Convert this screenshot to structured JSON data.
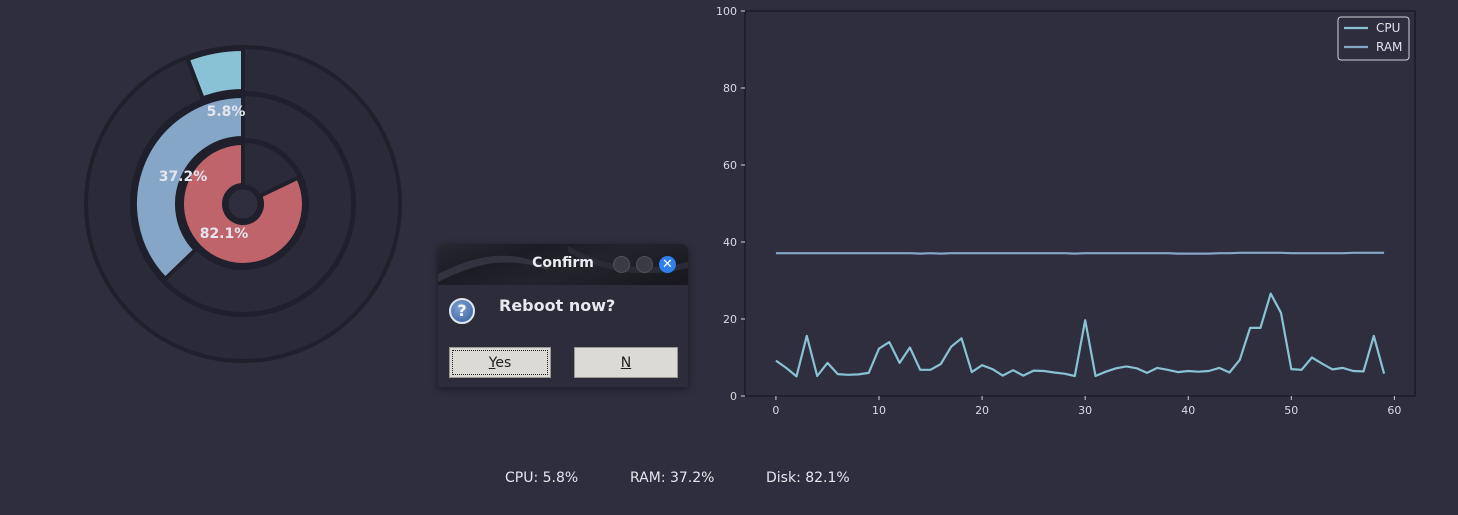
{
  "gauge": {
    "rings": [
      {
        "name": "CPU",
        "percent": 5.8,
        "label": "5.8%",
        "color": "#89c2d4"
      },
      {
        "name": "RAM",
        "percent": 37.2,
        "label": "37.2%",
        "color": "#86a6c7"
      },
      {
        "name": "Disk",
        "percent": 82.1,
        "label": "82.1%",
        "color": "#c0646b"
      }
    ],
    "track_color": "#20202c"
  },
  "chart_data": {
    "type": "line",
    "xlim": [
      -3,
      62
    ],
    "ylim": [
      0,
      100
    ],
    "x_ticks": [
      0,
      10,
      20,
      30,
      40,
      50,
      60
    ],
    "y_ticks": [
      0,
      20,
      40,
      60,
      80,
      100
    ],
    "legend": {
      "position": "top-right",
      "entries": [
        "CPU",
        "RAM"
      ]
    },
    "grid": false,
    "series": [
      {
        "name": "CPU",
        "color": "#89c2d4",
        "values": [
          9.2,
          7.3,
          5.1,
          15.6,
          5.2,
          8.6,
          5.7,
          5.5,
          5.6,
          6.0,
          12.3,
          14.0,
          8.6,
          12.6,
          6.8,
          6.8,
          8.3,
          12.8,
          15.0,
          6.2,
          8.0,
          7.0,
          5.3,
          6.7,
          5.3,
          6.6,
          6.5,
          6.1,
          5.8,
          5.2,
          19.7,
          5.2,
          6.3,
          7.2,
          7.7,
          7.2,
          6.0,
          7.3,
          6.8,
          6.2,
          6.5,
          6.3,
          6.5,
          7.3,
          6.1,
          9.4,
          17.7,
          17.7,
          26.6,
          21.6,
          7.0,
          6.8,
          10.0,
          8.4,
          6.9,
          7.3,
          6.5,
          6.4,
          15.6,
          5.8
        ]
      },
      {
        "name": "RAM",
        "color": "#86a6c7",
        "values": [
          37.1,
          37.1,
          37.1,
          37.1,
          37.1,
          37.1,
          37.1,
          37.1,
          37.1,
          37.1,
          37.1,
          37.1,
          37.1,
          37.1,
          37.0,
          37.1,
          37.0,
          37.1,
          37.1,
          37.1,
          37.1,
          37.1,
          37.1,
          37.1,
          37.1,
          37.1,
          37.1,
          37.1,
          37.1,
          37.0,
          37.1,
          37.1,
          37.1,
          37.1,
          37.1,
          37.1,
          37.1,
          37.1,
          37.1,
          37.0,
          37.0,
          37.0,
          37.0,
          37.1,
          37.1,
          37.2,
          37.2,
          37.2,
          37.2,
          37.2,
          37.1,
          37.1,
          37.1,
          37.1,
          37.1,
          37.1,
          37.2,
          37.2,
          37.2,
          37.2
        ]
      }
    ]
  },
  "dialog": {
    "title": "Confirm",
    "message": "Reboot now?",
    "yes_rest": "es",
    "yes_mnemonic": "Y",
    "no_rest": "",
    "no_mnemonic": "N",
    "icon": "question-icon",
    "close_glyph": "✕"
  },
  "status": {
    "cpu": "CPU: 5.8%",
    "ram": "RAM: 37.2%",
    "disk": "Disk: 82.1%"
  }
}
